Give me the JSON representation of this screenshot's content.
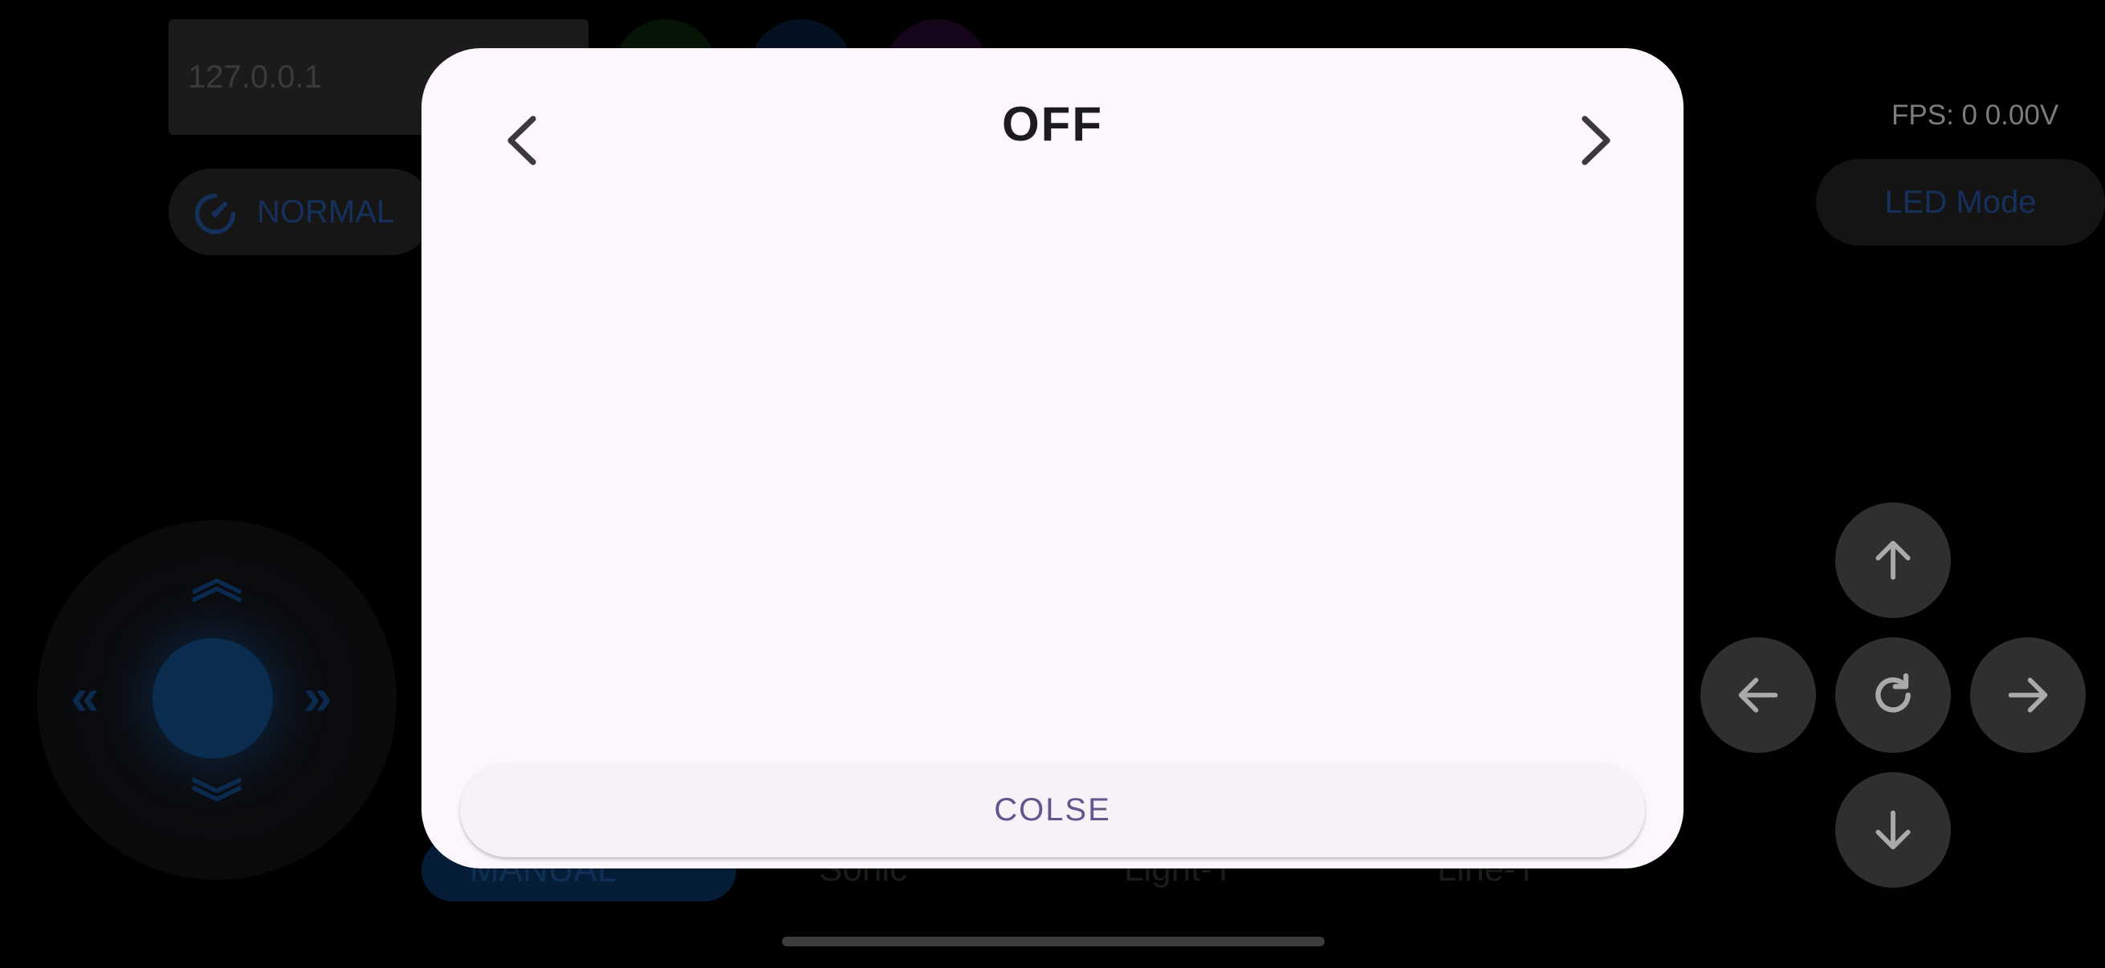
{
  "app": {
    "ip_address": "127.0.0.1",
    "speed_mode_label": "NORMAL",
    "fps_label": "FPS: 0  0.00V",
    "led_mode_label": "LED Mode",
    "tabs": [
      {
        "label": "MANUAL",
        "icon": "robot-icon"
      },
      {
        "label": "Sonic",
        "icon": "waves-icon"
      },
      {
        "label": "Light-T",
        "icon": "sun-icon"
      },
      {
        "label": "Line-T",
        "icon": "dots-icon"
      }
    ],
    "color_dots": [
      "#051405",
      "#03101f",
      "#15041a"
    ]
  },
  "dialog": {
    "title": "OFF",
    "close_label": "COLSE",
    "accent_color": "#65558f"
  }
}
